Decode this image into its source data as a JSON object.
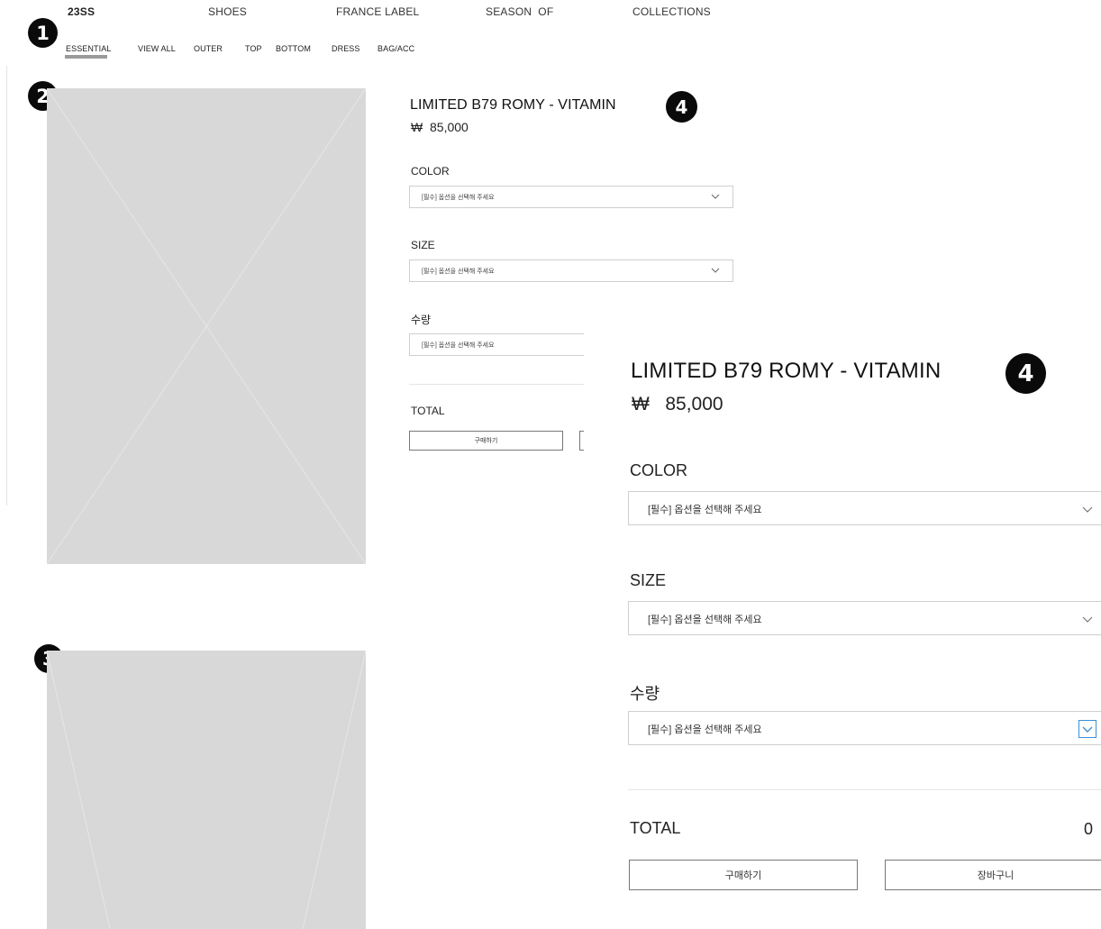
{
  "nav": {
    "main": [
      "23SS",
      "SHOES",
      "FRANCE LABEL",
      "SEASON  OF",
      "COLLECTIONS"
    ],
    "sub": [
      "ESSENTIAL",
      "VIEW ALL",
      "OUTER",
      "TOP",
      "BOTTOM",
      "DRESS",
      "BAG/ACC"
    ],
    "active_sub": "ESSENTIAL"
  },
  "badges": [
    "1",
    "2",
    "3",
    "4"
  ],
  "product": {
    "name": "LIMITED B79 ROMY - VITAMIN",
    "currency_symbol": "₩",
    "price": "85,000",
    "options": [
      {
        "label": "COLOR",
        "placeholder": "[필수] 옵션을 선택해 주세요"
      },
      {
        "label": "SIZE",
        "placeholder": "[필수] 옵션을 선택해 주세요"
      },
      {
        "label": "수량",
        "placeholder": "[필수] 옵션을 선택해 주세요"
      }
    ],
    "total_label": "TOTAL",
    "total_value": "0",
    "buy_label": "구매하기",
    "cart_label": "장바구니"
  },
  "icons": {
    "dropdown": "chevron-down-icon",
    "placeholder": "image-placeholder-icon"
  },
  "colors": {
    "placeholder_fill": "#d8d8d8",
    "active_underline": "#9a9a9a",
    "focus_outline": "#3a8fd8",
    "badge": "#0a0a0a"
  }
}
